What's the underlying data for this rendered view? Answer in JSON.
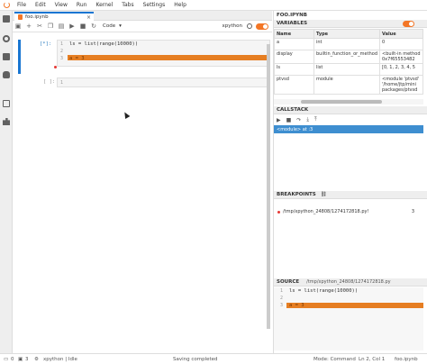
{
  "menu": [
    "File",
    "Edit",
    "View",
    "Run",
    "Kernel",
    "Tabs",
    "Settings",
    "Help"
  ],
  "notebook": {
    "tab_label": "foo.ipynb",
    "tab_close": "×",
    "cell_type": "Code",
    "kernel": "xpython",
    "toolbar_icons": [
      "save-icon",
      "add-icon",
      "cut-icon",
      "copy-icon",
      "paste-icon",
      "run-icon",
      "stop-icon",
      "restart-icon"
    ]
  },
  "cell1": {
    "prompt": "[*]:",
    "lines": [
      {
        "num": "1",
        "code": "ls = list(range(10000))"
      },
      {
        "num": "2",
        "code": ""
      },
      {
        "num": "3",
        "code": "a = 3"
      }
    ]
  },
  "cell2": {
    "prompt": "[ ]:",
    "line_num": "1"
  },
  "debugger": {
    "file_title": "FOO.IPYNB",
    "variables_title": "VARIABLES",
    "columns": [
      "Name",
      "Type",
      "Value"
    ],
    "variables": [
      {
        "name": "a",
        "type": "int",
        "value": "0"
      },
      {
        "name": "display",
        "type": "builtin_function_or_method",
        "value": "<built-in method\n0x7f65553482"
      },
      {
        "name": "ls",
        "type": "list",
        "value": "[0, 1, 2, 3, 4, 5"
      },
      {
        "name": "ptvsd",
        "type": "module",
        "value": "<module 'ptvsd'\n'/home/jtp/mini\npackages/ptvsd"
      }
    ],
    "callstack_title": "CALLSTACK",
    "callstack_row": "<module> at :3",
    "breakpoints_title": "BREAKPOINTS",
    "breakpoint_path": "/tmp/xpython_24808/1274172818.py!",
    "breakpoint_line": "3",
    "source_title": "SOURCE",
    "source_path": "/tmp/xpython_24808/1274172818.py",
    "source_lines": [
      {
        "num": "1",
        "code": "ls = list(range(10000))"
      },
      {
        "num": "2",
        "code": ""
      },
      {
        "num": "3",
        "code": "a = 3"
      }
    ]
  },
  "status": {
    "zero": "0",
    "three": "3",
    "kernel_status": "xpython | Idle",
    "message": "Saving completed",
    "mode": "Mode: Command",
    "position": "Ln 2, Col 1",
    "file": "foo.ipynb"
  }
}
